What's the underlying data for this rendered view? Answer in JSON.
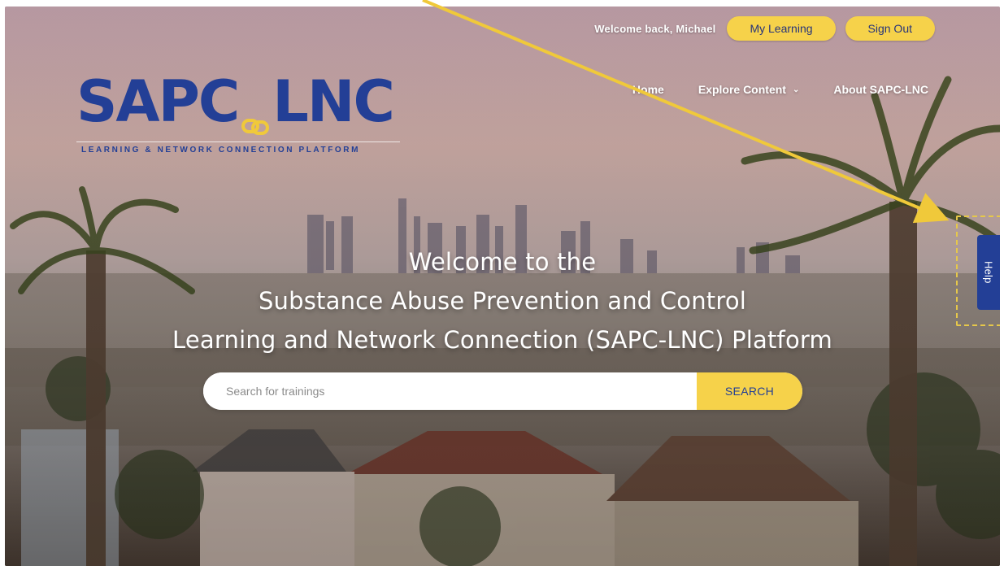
{
  "top": {
    "welcome": "Welcome back, Michael",
    "my_learning": "My Learning",
    "sign_out": "Sign Out"
  },
  "logo": {
    "left": "SAPC",
    "right": "LNC",
    "tagline": "LEARNING & NETWORK CONNECTION PLATFORM"
  },
  "nav": {
    "home": "Home",
    "explore": "Explore Content",
    "about": "About SAPC-LNC"
  },
  "hero": {
    "line1": "Welcome to the",
    "line2": "Substance Abuse Prevention and Control",
    "line3": "Learning and Network Connection (SAPC-LNC) Platform"
  },
  "search": {
    "placeholder": "Search for trainings",
    "button": "SEARCH"
  },
  "help": {
    "label": "Help"
  },
  "colors": {
    "brand_blue": "#233f96",
    "accent_yellow": "#f6d24a"
  },
  "icons": {
    "explore_dropdown": "chevron-down-icon",
    "logo_link": "chain-link-icon"
  }
}
